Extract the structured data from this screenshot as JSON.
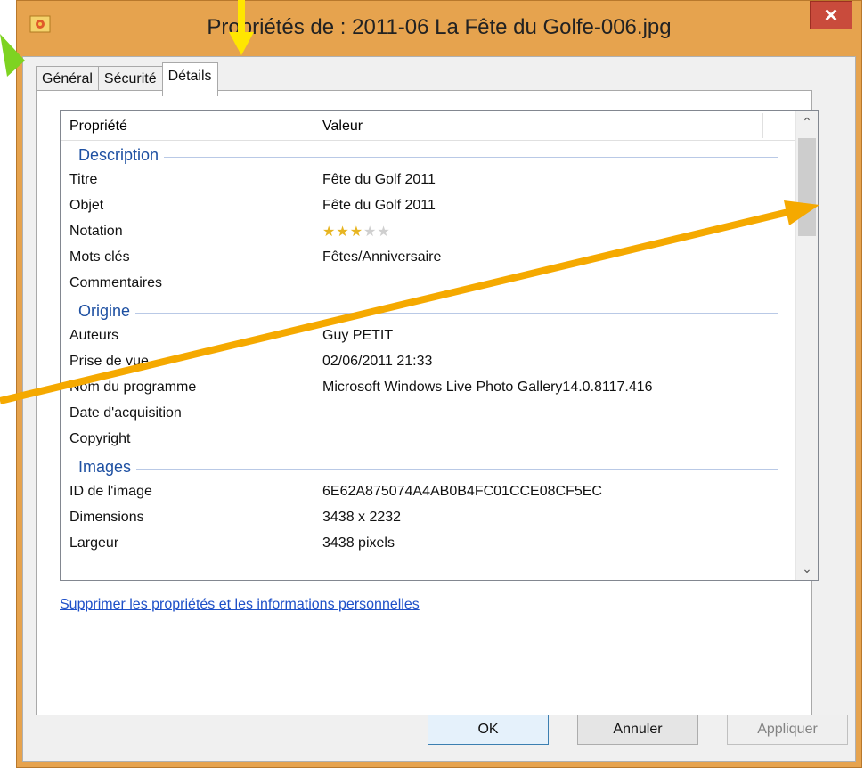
{
  "window": {
    "title": "Propriétés de : 2011-06 La Fête du Golfe-006.jpg",
    "close_label": "✕"
  },
  "tabs": [
    {
      "label": "Général",
      "active": false
    },
    {
      "label": "Sécurité",
      "active": false
    },
    {
      "label": "Détails",
      "active": true
    }
  ],
  "list": {
    "col_property": "Propriété",
    "col_value": "Valeur",
    "groups": {
      "description": "Description",
      "origin": "Origine",
      "images": "Images"
    },
    "rows": {
      "title": {
        "name": "Titre",
        "value": "Fête du Golf 2011"
      },
      "subject": {
        "name": "Objet",
        "value": "Fête du Golf 2011"
      },
      "rating": {
        "name": "Notation",
        "stars_filled": 3,
        "stars_total": 5
      },
      "keywords": {
        "name": "Mots clés",
        "value": "Fêtes/Anniversaire"
      },
      "comments": {
        "name": "Commentaires",
        "value": ""
      },
      "authors": {
        "name": "Auteurs",
        "value": "Guy PETIT"
      },
      "taken": {
        "name": "Prise de vue",
        "value": "02/06/2011 21:33"
      },
      "program": {
        "name": "Nom du programme",
        "value": "Microsoft Windows Live Photo Gallery14.0.8117.416"
      },
      "acquired": {
        "name": "Date d'acquisition",
        "value": ""
      },
      "copyright": {
        "name": "Copyright",
        "value": ""
      },
      "image_id": {
        "name": "ID de l'image",
        "value": "6E62A875074A4AB0B4FC01CCE08CF5EC"
      },
      "dimensions": {
        "name": "Dimensions",
        "value": "3438 x 2232"
      },
      "width": {
        "name": "Largeur",
        "value": "3438 pixels"
      }
    }
  },
  "link_remove": "Supprimer les propriétés et les informations personnelles",
  "buttons": {
    "ok": "OK",
    "cancel": "Annuler",
    "apply": "Appliquer"
  },
  "colors": {
    "frame": "#e6a34e",
    "close": "#c94b3c",
    "group_title": "#1e50a2",
    "link": "#1e50c8",
    "arrow_orange": "#f5a900",
    "arrow_yellow": "#ffe600",
    "arrow_green": "#7ed321"
  }
}
